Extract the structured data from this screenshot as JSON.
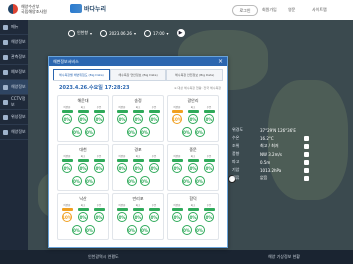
{
  "header": {
    "org_line1": "해양수산부",
    "org_line2": "국립해양조사원",
    "service_logo": "바다누리",
    "buttons": [
      "로그인",
      "회원가입",
      "영문",
      "사이트맵"
    ],
    "links": [
      "공지사항"
    ]
  },
  "sidebar": {
    "items": [
      {
        "label": "메뉴",
        "icon": "menu-icon"
      },
      {
        "label": "해양정보",
        "icon": "anchor-icon"
      },
      {
        "label": "관측정보",
        "icon": "pin-icon"
      },
      {
        "label": "예보정보",
        "icon": "chart-icon"
      },
      {
        "label": "해양정보",
        "icon": "layers-icon"
      },
      {
        "label": "CCTV정보",
        "icon": "camera-icon"
      },
      {
        "label": "위성정보",
        "icon": "satellite-icon"
      },
      {
        "label": "해양정보",
        "icon": "info-icon"
      }
    ]
  },
  "toolbar": {
    "location": "인천항",
    "date": "2023.06.26",
    "time": "17:00"
  },
  "dialog": {
    "title": "해변정보서비스",
    "close": "×",
    "tabs": [
      "해수욕장별 해변위험도 (Big Data)",
      "해수욕장 연안정보 (Big Data)",
      "해수욕장 안전정보 (Big Data)"
    ],
    "timestamp": "2023.4.26.수요일 17:28:23",
    "note": "※ 대상 해수욕장 현황: 전국 해수욕장"
  },
  "cards": [
    {
      "name": "해운대",
      "labels": [
        "이안류",
        "파고",
        "수온"
      ],
      "levels": [
        "0%",
        "0%",
        "0%"
      ],
      "warn": [
        false,
        false,
        false
      ],
      "row2": [
        "0%",
        "0%"
      ]
    },
    {
      "name": "송정",
      "labels": [
        "이안류",
        "파고",
        "수온"
      ],
      "levels": [
        "0%",
        "0%",
        "0%"
      ],
      "warn": [
        false,
        false,
        false
      ],
      "row2": [
        "0%",
        "0%"
      ]
    },
    {
      "name": "광안리",
      "labels": [
        "이안류",
        "파고",
        "수온"
      ],
      "levels": [
        "10%",
        "0%",
        "0%"
      ],
      "warn": [
        true,
        false,
        false
      ],
      "row2": [
        "0%",
        "0%"
      ]
    },
    {
      "name": "대천",
      "labels": [
        "이안류",
        "파고",
        "수온"
      ],
      "levels": [
        "0%",
        "0%",
        "0%"
      ],
      "warn": [
        false,
        false,
        false
      ],
      "row2": [
        "0%",
        "0%"
      ]
    },
    {
      "name": "경포",
      "labels": [
        "이안류",
        "파고",
        "수온"
      ],
      "levels": [
        "0%",
        "0%",
        "0%"
      ],
      "warn": [
        false,
        false,
        false
      ],
      "row2": [
        "0%",
        "0%"
      ]
    },
    {
      "name": "중문",
      "labels": [
        "이안류",
        "파고",
        "수온"
      ],
      "levels": [
        "0%",
        "0%",
        "0%"
      ],
      "warn": [
        false,
        false,
        false
      ],
      "row2": [
        "0%",
        "0%"
      ]
    },
    {
      "name": "낙산",
      "labels": [
        "이안류",
        "파고",
        "수온"
      ],
      "levels": [
        "10%",
        "0%",
        "0%"
      ],
      "warn": [
        true,
        false,
        false
      ],
      "row2": [
        "0%",
        "0%"
      ]
    },
    {
      "name": "만리포",
      "labels": [
        "이안류",
        "파고",
        "수온"
      ],
      "levels": [
        "0%",
        "0%",
        "0%"
      ],
      "warn": [
        false,
        false,
        false
      ],
      "row2": [
        "0%",
        "0%"
      ]
    },
    {
      "name": "함덕",
      "labels": [
        "이안류",
        "파고",
        "수온"
      ],
      "levels": [
        "0%",
        "0%",
        "0%"
      ],
      "warn": [
        false,
        false,
        false
      ],
      "row2": [
        "0%",
        "0%"
      ]
    }
  ],
  "info": {
    "rows": [
      {
        "k": "위경도",
        "v": "37°29'N 126°36'E"
      },
      {
        "k": "수온",
        "v": "16.2°C"
      },
      {
        "k": "조위",
        "v": "최고 / 최저"
      },
      {
        "k": "풍향",
        "v": "NW 3.2m/s"
      },
      {
        "k": "파고",
        "v": "0.5m"
      },
      {
        "k": "기압",
        "v": "1013.2hPa"
      },
      {
        "k": "해류",
        "v": "없음"
      }
    ]
  },
  "footer": {
    "left": "인천광역시 연평도",
    "right": "해양 기상정보 현황"
  },
  "colors": {
    "accent": "#2b66b0",
    "safe": "#2faa5a",
    "warn": "#f0a020"
  }
}
